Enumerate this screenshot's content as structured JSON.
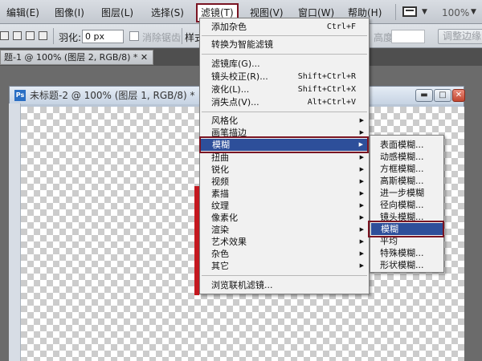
{
  "menubar": {
    "items": [
      {
        "label": "编辑(E)"
      },
      {
        "label": "图像(I)"
      },
      {
        "label": "图层(L)"
      },
      {
        "label": "选择(S)"
      },
      {
        "label": "滤镜(T)"
      },
      {
        "label": "视图(V)"
      },
      {
        "label": "窗口(W)"
      },
      {
        "label": "帮助(H)"
      }
    ],
    "zoom": "100%"
  },
  "options": {
    "feather_label": "羽化:",
    "feather_value": "0 px",
    "antialias_label": "消除锯齿",
    "style_label": "样式",
    "height_label": "高度:",
    "refine_button": "调整边缘"
  },
  "tabs": {
    "doc1": "题-1 @ 100% (图层 2, RGB/8) * ✕"
  },
  "document": {
    "title": "未标题-2 @ 100% (图层 1, RGB/8) *",
    "ps_icon": "Ps"
  },
  "filter_menu": {
    "items": [
      {
        "label": "添加杂色",
        "shortcut": "Ctrl+F"
      },
      {
        "label": "转换为智能滤镜"
      },
      {
        "label": "滤镜库(G)..."
      },
      {
        "label": "镜头校正(R)...",
        "shortcut": "Shift+Ctrl+R"
      },
      {
        "label": "液化(L)...",
        "shortcut": "Shift+Ctrl+X"
      },
      {
        "label": "消失点(V)...",
        "shortcut": "Alt+Ctrl+V"
      },
      {
        "label": "风格化"
      },
      {
        "label": "画笔描边"
      },
      {
        "label": "模糊"
      },
      {
        "label": "扭曲"
      },
      {
        "label": "锐化"
      },
      {
        "label": "视频"
      },
      {
        "label": "素描"
      },
      {
        "label": "纹理"
      },
      {
        "label": "像素化"
      },
      {
        "label": "渲染"
      },
      {
        "label": "艺术效果"
      },
      {
        "label": "杂色"
      },
      {
        "label": "其它"
      },
      {
        "label": "浏览联机滤镜..."
      }
    ]
  },
  "blur_submenu": {
    "items": [
      {
        "label": "表面模糊..."
      },
      {
        "label": "动感模糊..."
      },
      {
        "label": "方框模糊..."
      },
      {
        "label": "高斯模糊..."
      },
      {
        "label": "进一步模糊"
      },
      {
        "label": "径向模糊..."
      },
      {
        "label": "镜头模糊..."
      },
      {
        "label": "模糊"
      },
      {
        "label": "平均"
      },
      {
        "label": "特殊模糊..."
      },
      {
        "label": "形状模糊..."
      }
    ]
  },
  "colors": {
    "highlight": "#2d4f9a",
    "annotation_border": "#7a1422"
  }
}
